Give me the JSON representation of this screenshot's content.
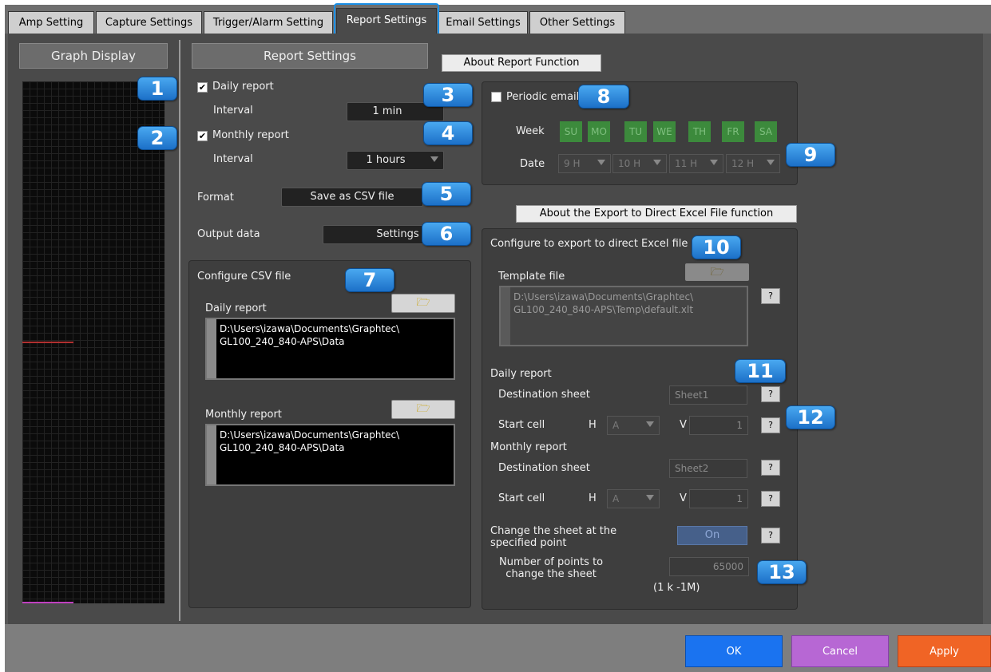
{
  "tabs": [
    {
      "label": "Amp Setting"
    },
    {
      "label": "Capture Settings"
    },
    {
      "label": "Trigger/Alarm Setting"
    },
    {
      "label": "Report Settings"
    },
    {
      "label": "Email Settings"
    },
    {
      "label": "Other Settings"
    }
  ],
  "graph_display": {
    "title": "Graph Display"
  },
  "report_settings": {
    "title": "Report Settings",
    "daily_report": {
      "label": "Daily report",
      "checked": true,
      "interval_label": "Interval",
      "interval_value": "1 min"
    },
    "monthly_report": {
      "label": "Monthly report",
      "checked": true,
      "interval_label": "Interval",
      "interval_value": "1 hours"
    },
    "format": {
      "label": "Format",
      "value": "Save as CSV file"
    },
    "output_data": {
      "label": "Output data",
      "button": "Settings"
    }
  },
  "csv": {
    "title": "Configure CSV file",
    "daily": {
      "label": "Daily report",
      "path_line1": "D:\\Users\\izawa\\Documents\\Graphtec\\",
      "path_line2": "GL100_240_840-APS\\Data"
    },
    "monthly": {
      "label": "Monthly report",
      "path_line1": "D:\\Users\\izawa\\Documents\\Graphtec\\",
      "path_line2": "GL100_240_840-APS\\Data"
    }
  },
  "about_report_button": "About Report Function",
  "periodic": {
    "label": "Periodic email",
    "checked": false,
    "week_label": "Week",
    "days": [
      "SU",
      "MO",
      "TU",
      "WE",
      "TH",
      "FR",
      "SA"
    ],
    "date_label": "Date",
    "hours": [
      "9 H",
      "10 H",
      "11 H",
      "12 H"
    ]
  },
  "about_excel_button": "About the Export to Direct Excel File function",
  "excel": {
    "title": "Configure to export to direct Excel file",
    "template_label": "Template file",
    "template_line1": "D:\\Users\\izawa\\Documents\\Graphtec\\",
    "template_line2": "GL100_240_840-APS\\Temp\\default.xlt",
    "help": "?",
    "daily": {
      "label": "Daily report",
      "dest_label": "Destination sheet",
      "dest_value": "Sheet1",
      "start_label": "Start cell",
      "h_label": "H",
      "h_value": "A",
      "v_label": "V",
      "v_value": "1"
    },
    "monthly": {
      "label": "Monthly report",
      "dest_label": "Destination sheet",
      "dest_value": "Sheet2",
      "start_label": "Start cell",
      "h_label": "H",
      "h_value": "A",
      "v_label": "V",
      "v_value": "1"
    },
    "change_line1": "Change the sheet at the",
    "change_line2": "specified point",
    "change_value": "On",
    "points_line1": "Number of points to",
    "points_line2": "change the sheet",
    "points_value": "65000",
    "points_range": "(1 k -1M)"
  },
  "badges": [
    "1",
    "2",
    "3",
    "4",
    "5",
    "6",
    "7",
    "8",
    "9",
    "10",
    "11",
    "12",
    "13"
  ],
  "footer": {
    "ok": "OK",
    "cancel": "Cancel",
    "apply": "Apply"
  },
  "colors": {
    "ok": "#1a73f0",
    "cancel": "#b767d4",
    "apply": "#f06425",
    "tab_highlight": "#1a8fe6",
    "badge": "#2a8be0",
    "day_enabled": "#3c8a3c"
  }
}
